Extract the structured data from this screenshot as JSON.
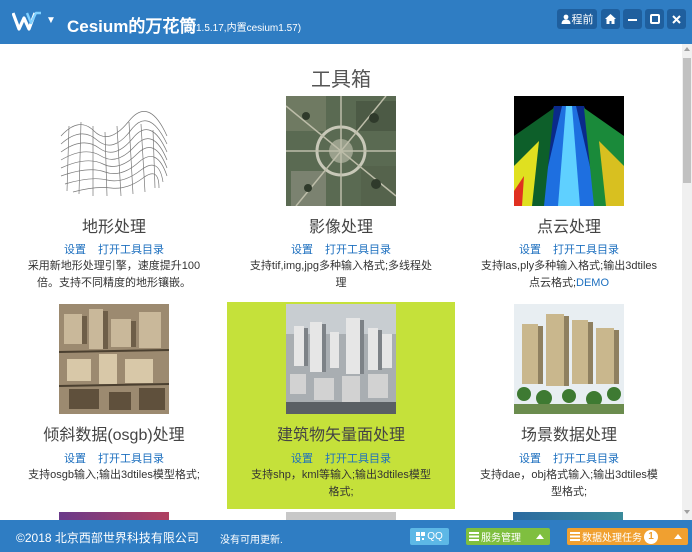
{
  "app": {
    "title": "Cesium的万花筒",
    "version": "(V1.5.17,内置cesium1.57)"
  },
  "header_buttons": {
    "user_label": "程前"
  },
  "page": {
    "title": "工具箱"
  },
  "tools": [
    {
      "name": "地形处理",
      "settings": "设置",
      "open_dir": "打开工具目录",
      "desc_lines": [
        "采用新地形处理引擎，速度提升100",
        "倍。支持不同精度的地形镶嵌。"
      ],
      "image": "terrain-wireframe"
    },
    {
      "name": "影像处理",
      "settings": "设置",
      "open_dir": "打开工具目录",
      "desc_lines": [
        "支持tif,img,jpg多种输入格式;多线程处",
        "理"
      ],
      "image": "aerial-imagery"
    },
    {
      "name": "点云处理",
      "settings": "设置",
      "open_dir": "打开工具目录",
      "desc_lines": [
        "支持las,ply多种输入格式;输出3dtiles",
        "点云格式;"
      ],
      "demo": "DEMO",
      "image": "point-cloud-road"
    },
    {
      "name": "倾斜数据(osgb)处理",
      "settings": "设置",
      "open_dir": "打开工具目录",
      "desc_lines": [
        "支持osgb输入;输出3dtiles模型格式;"
      ],
      "image": "oblique-city"
    },
    {
      "name": "建筑物矢量面处理",
      "settings": "设置",
      "open_dir": "打开工具目录",
      "desc_lines": [
        "支持shp，kml等输入;输出3dtiles模型",
        "格式;"
      ],
      "image": "building-vector-city",
      "highlighted": true
    },
    {
      "name": "场景数据处理",
      "settings": "设置",
      "open_dir": "打开工具目录",
      "desc_lines": [
        "支持dae，obj格式输入;输出3dtiles模",
        "型格式;"
      ],
      "image": "scene-buildings"
    }
  ],
  "statusbar": {
    "copyright": "©2018 北京西部世界科技有限公司",
    "update": "没有可用更新.",
    "qq": "QQ",
    "service": "服务管理",
    "tasks": "数据处理任务",
    "task_count": "1"
  },
  "colors": {
    "primary": "#2f7dc3",
    "highlight": "#c5e13a",
    "link": "#1c6fbf",
    "qq": "#5db8e6",
    "service": "#7fbf3f",
    "tasks": "#f0a030"
  }
}
